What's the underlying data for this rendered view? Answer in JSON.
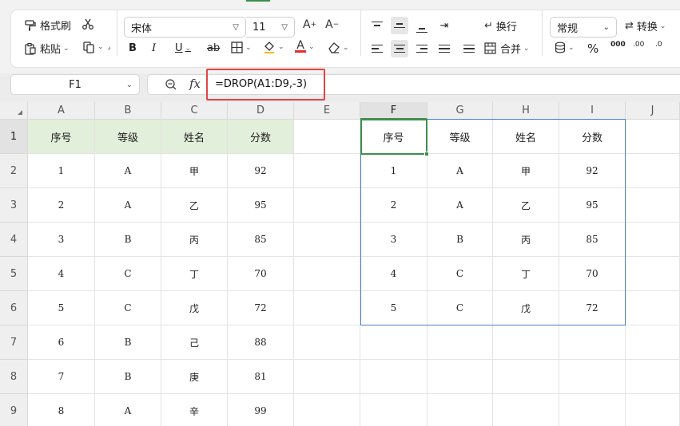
{
  "toolbar": {
    "format_painter": "格式刷",
    "paste": "粘贴",
    "font_name": "宋体",
    "font_size": "11",
    "wrap_text": "换行",
    "merge": "合并",
    "number_format": "常规",
    "convert": "转换",
    "bold": "B",
    "italic": "I",
    "underline": "U",
    "strike": "ab",
    "percent": "%",
    "thousands": "000",
    "dec_inc": ".00",
    "dec_dec": ".0"
  },
  "formula_bar": {
    "name_box": "F1",
    "fx": "fx",
    "formula": "=DROP(A1:D9,-3)"
  },
  "grid": {
    "columns": [
      "A",
      "B",
      "C",
      "D",
      "E",
      "F",
      "G",
      "H",
      "I",
      "J"
    ],
    "rows": [
      "1",
      "2",
      "3",
      "4",
      "5",
      "6",
      "7",
      "8",
      "9"
    ],
    "source_headers": [
      "序号",
      "等级",
      "姓名",
      "分数"
    ],
    "source_rows": [
      [
        "1",
        "A",
        "甲",
        "92"
      ],
      [
        "2",
        "A",
        "乙",
        "95"
      ],
      [
        "3",
        "B",
        "丙",
        "85"
      ],
      [
        "4",
        "C",
        "丁",
        "70"
      ],
      [
        "5",
        "C",
        "戊",
        "72"
      ],
      [
        "6",
        "B",
        "己",
        "88"
      ],
      [
        "7",
        "B",
        "庚",
        "81"
      ],
      [
        "8",
        "A",
        "辛",
        "99"
      ]
    ],
    "result_headers": [
      "序号",
      "等级",
      "姓名",
      "分数"
    ],
    "result_rows": [
      [
        "1",
        "A",
        "甲",
        "92"
      ],
      [
        "2",
        "A",
        "乙",
        "95"
      ],
      [
        "3",
        "B",
        "丙",
        "85"
      ],
      [
        "4",
        "C",
        "丁",
        "70"
      ],
      [
        "5",
        "C",
        "戊",
        "72"
      ]
    ]
  },
  "colors": {
    "header_fill": "#e2efda",
    "selection": "#3c8f4d",
    "spill_border": "#4a7fc4",
    "highlight": "#e04545"
  }
}
